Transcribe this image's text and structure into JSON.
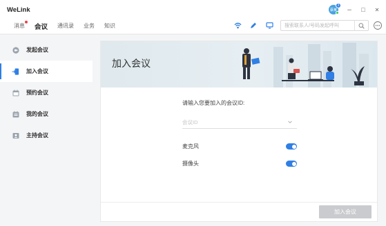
{
  "app": {
    "title": "WeLink"
  },
  "nav": {
    "tabs": [
      {
        "label": "消息",
        "badge": true
      },
      {
        "label": "会议",
        "active": true
      },
      {
        "label": "通讯录"
      },
      {
        "label": "业务"
      },
      {
        "label": "知识"
      }
    ]
  },
  "avatar": {
    "initials": "蔡某",
    "badge_count": "3"
  },
  "search": {
    "placeholder": "搜索联系人/号码发起呼叫"
  },
  "icons": [
    "wifi-icon",
    "pencil-icon",
    "screen-share-icon",
    "search-icon",
    "more-icon",
    "minimize-icon",
    "maximize-icon",
    "close-icon"
  ],
  "window_controls": {
    "minimize": "–",
    "maximize": "□",
    "close": "✕"
  },
  "sidebar": {
    "items": [
      {
        "label": "发起会议",
        "icon": "video-icon"
      },
      {
        "label": "加入会议",
        "icon": "enter-door-icon",
        "active": true
      },
      {
        "label": "预约会议",
        "icon": "calendar-icon"
      },
      {
        "label": "我的会议",
        "icon": "list-calendar-icon"
      },
      {
        "label": "主持会议",
        "icon": "host-icon"
      }
    ]
  },
  "main": {
    "banner_title": "加入会议",
    "prompt": "请输入您要加入的会议ID:",
    "meeting_id_placeholder": "会议ID",
    "options": [
      {
        "label": "麦克风",
        "enabled": true
      },
      {
        "label": "摄像头",
        "enabled": true
      }
    ],
    "join_button": "加入会议"
  },
  "colors": {
    "accent": "#2f7fe4",
    "sidebar_bg": "#f4f5f7",
    "disabled_button": "#c9cbce",
    "banner": "#dfe9ee"
  }
}
